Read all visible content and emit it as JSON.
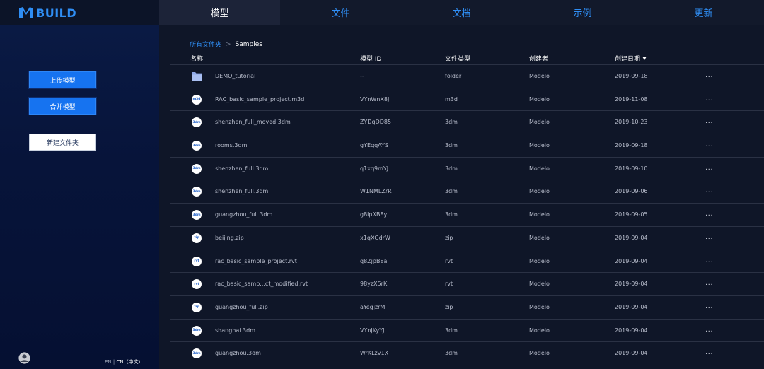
{
  "brand": {
    "text": "BUILD",
    "accent_color": "#2f8ef5"
  },
  "nav": {
    "tabs": [
      {
        "label": "模型",
        "active": true
      },
      {
        "label": "文件",
        "active": false
      },
      {
        "label": "文档",
        "active": false
      },
      {
        "label": "示例",
        "active": false
      },
      {
        "label": "更新",
        "active": false
      }
    ]
  },
  "sidebar": {
    "upload_label": "上传模型",
    "merge_label": "合并模型",
    "new_folder_label": "新建文件夹",
    "lang_en": "EN",
    "lang_sep": " | ",
    "lang_cn": "CN（中文）",
    "avatar_icon": "user-avatar-icon"
  },
  "breadcrumb": {
    "root": "所有文件夹",
    "separator": ">",
    "current": "Samples"
  },
  "table": {
    "headers": {
      "name": "名称",
      "model_id": "模型 ID",
      "file_type": "文件类型",
      "creator": "创建者",
      "created_date": "创建日期"
    },
    "more_label": "...",
    "rows": [
      {
        "badge": "folder",
        "name": "DEMO_tutorial",
        "id": "--",
        "type": "folder",
        "creator": "Modelo",
        "date": "2019-09-18"
      },
      {
        "badge": "m3d",
        "name": "RAC_basic_sample_project.m3d",
        "id": "VYnWnX8J",
        "type": "m3d",
        "creator": "Modelo",
        "date": "2019-11-08"
      },
      {
        "badge": "3dm",
        "name": "shenzhen_full_moved.3dm",
        "id": "ZYDqDD85",
        "type": "3dm",
        "creator": "Modelo",
        "date": "2019-10-23"
      },
      {
        "badge": "3dm",
        "name": "rooms.3dm",
        "id": "gYEqqAYS",
        "type": "3dm",
        "creator": "Modelo",
        "date": "2019-09-18"
      },
      {
        "badge": "3dm",
        "name": "shenzhen_full.3dm",
        "id": "q1xq9mYJ",
        "type": "3dm",
        "creator": "Modelo",
        "date": "2019-09-10"
      },
      {
        "badge": "3dm",
        "name": "shenzhen_full.3dm",
        "id": "W1NMLZrR",
        "type": "3dm",
        "creator": "Modelo",
        "date": "2019-09-06"
      },
      {
        "badge": "3dm",
        "name": "guangzhou_full.3dm",
        "id": "g8lpXB8y",
        "type": "3dm",
        "creator": "Modelo",
        "date": "2019-09-05"
      },
      {
        "badge": "zip",
        "name": "beijing.zip",
        "id": "x1qXGdrW",
        "type": "zip",
        "creator": "Modelo",
        "date": "2019-09-04"
      },
      {
        "badge": "rvt",
        "name": "rac_basic_sample_project.rvt",
        "id": "q8ZjpB8a",
        "type": "rvt",
        "creator": "Modelo",
        "date": "2019-09-04"
      },
      {
        "badge": "rvt",
        "name": "rac_basic_samp...ct_modified.rvt",
        "id": "98yzX5rK",
        "type": "rvt",
        "creator": "Modelo",
        "date": "2019-09-04"
      },
      {
        "badge": "zip",
        "name": "guangzhou_full.zip",
        "id": "aYegjzrM",
        "type": "zip",
        "creator": "Modelo",
        "date": "2019-09-04"
      },
      {
        "badge": "3dm",
        "name": "shanghai.3dm",
        "id": "VYnJKyYJ",
        "type": "3dm",
        "creator": "Modelo",
        "date": "2019-09-04"
      },
      {
        "badge": "3dm",
        "name": "guangzhou.3dm",
        "id": "WrKLzv1X",
        "type": "3dm",
        "creator": "Modelo",
        "date": "2019-09-04"
      }
    ]
  }
}
